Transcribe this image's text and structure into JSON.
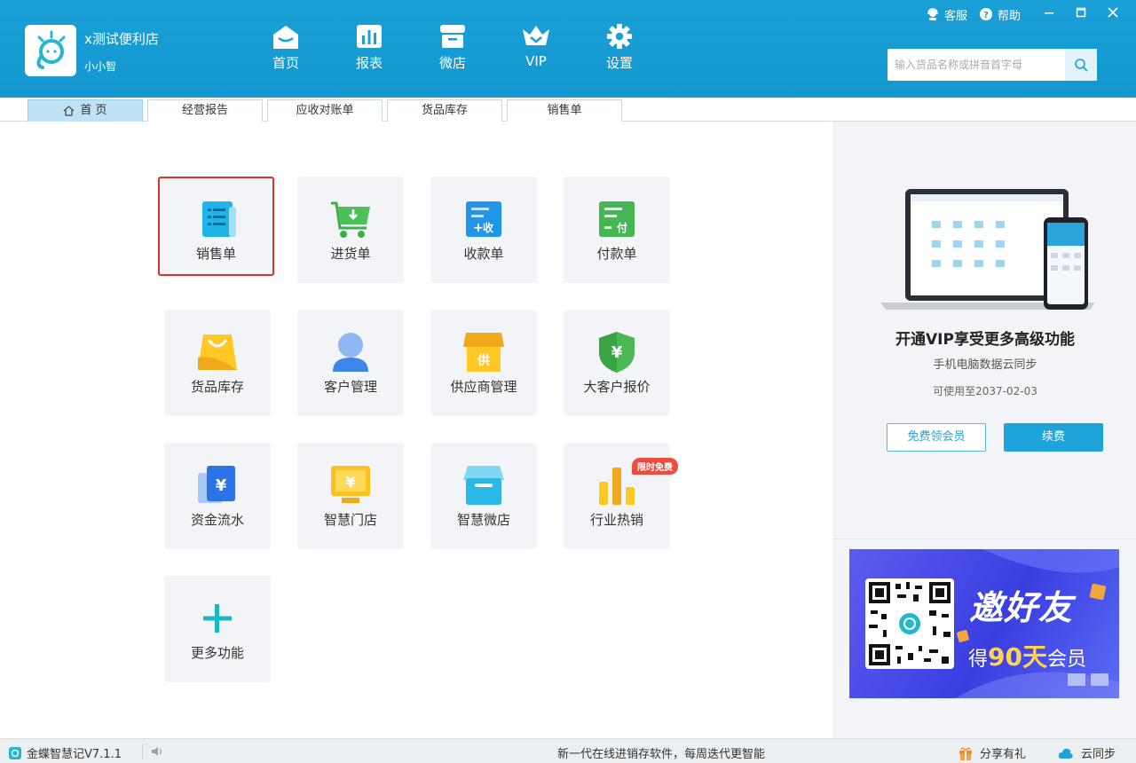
{
  "header": {
    "store_name": "x测试便利店",
    "user_name": "小小智",
    "nav": [
      {
        "label": "首页",
        "icon": "home-icon"
      },
      {
        "label": "报表",
        "icon": "chart-icon"
      },
      {
        "label": "微店",
        "icon": "shop-icon"
      },
      {
        "label": "VIP",
        "icon": "crown-icon"
      },
      {
        "label": "设置",
        "icon": "gear-icon"
      }
    ],
    "service_label": "客服",
    "help_label": "帮助",
    "search_placeholder": "输入货品名称或拼音首字母",
    "accent_color": "#1a9fd6"
  },
  "tabs": [
    {
      "label": "首 页",
      "active": true
    },
    {
      "label": "经营报告"
    },
    {
      "label": "应收对账单"
    },
    {
      "label": "货品库存"
    },
    {
      "label": "销售单"
    }
  ],
  "functions": [
    {
      "label": "销售单",
      "icon": "sales-order-icon",
      "selected": true
    },
    {
      "label": "进货单",
      "icon": "purchase-cart-icon"
    },
    {
      "label": "收款单",
      "icon": "receipt-icon",
      "mark": "收"
    },
    {
      "label": "付款单",
      "icon": "payment-icon",
      "mark": "付"
    },
    {
      "label": "货品库存",
      "icon": "bag-icon"
    },
    {
      "label": "客户管理",
      "icon": "customer-icon"
    },
    {
      "label": "供应商管理",
      "icon": "supplier-icon",
      "mark": "供"
    },
    {
      "label": "大客户报价",
      "icon": "shield-price-icon",
      "mark": "¥"
    },
    {
      "label": "资金流水",
      "icon": "money-flow-icon",
      "mark": "¥"
    },
    {
      "label": "智慧门店",
      "icon": "monitor-icon",
      "mark": "¥"
    },
    {
      "label": "智慧微店",
      "icon": "microshop-icon"
    },
    {
      "label": "行业热销",
      "icon": "bar-chart-icon"
    },
    {
      "label": "更多功能",
      "icon": "plus-icon"
    }
  ],
  "badge": "限时免费",
  "vip": {
    "title": "开通VIP享受更多高级功能",
    "subtitle": "手机电脑数据云同步",
    "valid_until": "可使用至2037-02-03",
    "free_button": "免费领会员",
    "renew_button": "续费"
  },
  "banner": {
    "headline": "邀好友",
    "line_prefix": "得",
    "days": "90天",
    "line_suffix": "会员"
  },
  "status": {
    "version": "金蝶智慧记V7.1.1",
    "message": "新一代在线进销存软件，每周迭代更智能",
    "share": "分享有礼",
    "sync": "云同步"
  }
}
